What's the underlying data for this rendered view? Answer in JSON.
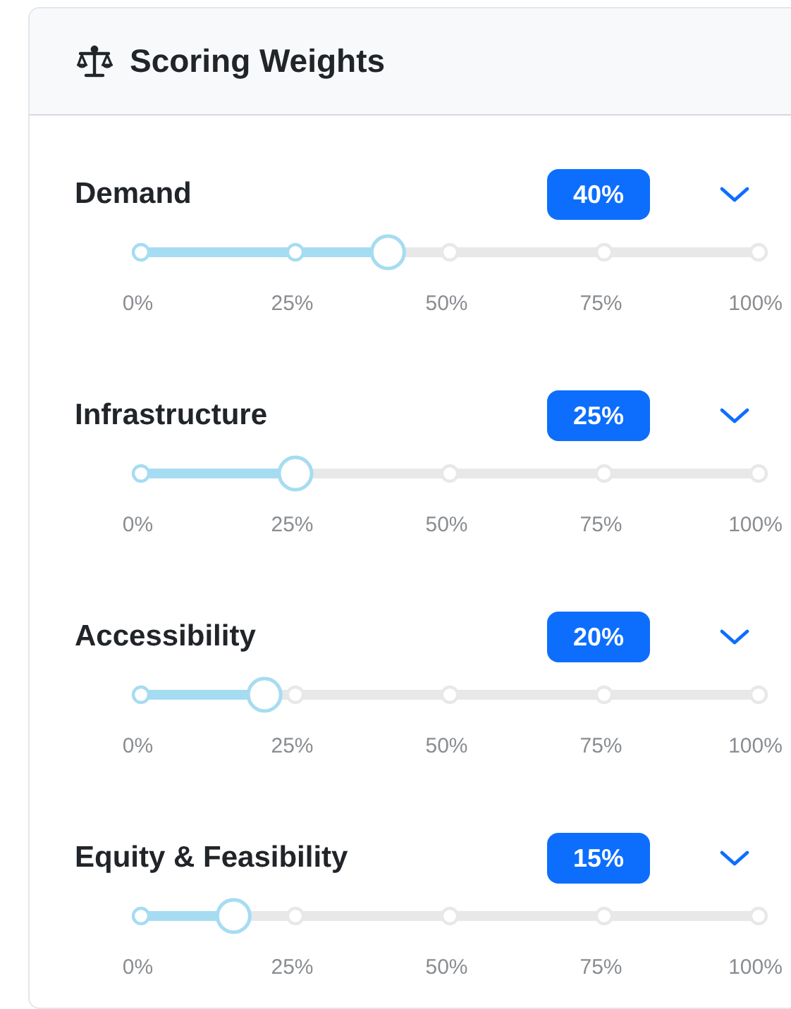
{
  "panel": {
    "title": "Scoring Weights"
  },
  "criteria": [
    {
      "name": "Demand",
      "weight": "40%",
      "level": 0.4,
      "ticks": [
        "0%",
        "25%",
        "50%",
        "75%",
        "100%"
      ]
    },
    {
      "name": "Infrastructure",
      "weight": "25%",
      "level": 0.25,
      "ticks": [
        "0%",
        "25%",
        "50%",
        "75%",
        "100%"
      ]
    },
    {
      "name": "Accessibility",
      "weight": "20%",
      "level": 0.2,
      "ticks": [
        "0%",
        "25%",
        "50%",
        "75%",
        "100%"
      ]
    },
    {
      "name": "Equity & Feasibility",
      "weight": "15%",
      "level": 0.15,
      "ticks": [
        "0%",
        "25%",
        "50%",
        "75%",
        "100%"
      ]
    }
  ]
}
